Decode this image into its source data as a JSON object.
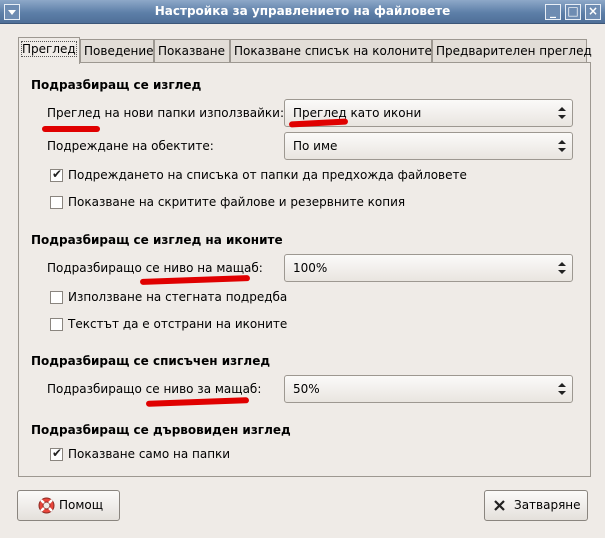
{
  "window": {
    "title": "Настройка за управлението на файловете"
  },
  "tabs": [
    {
      "label": "Преглед",
      "active": true
    },
    {
      "label": "Поведение",
      "active": false
    },
    {
      "label": "Показване",
      "active": false
    },
    {
      "label": "Показване списък на колоните",
      "active": false
    },
    {
      "label": "Предварителен преглед",
      "active": false
    }
  ],
  "default_view": {
    "heading": "Подразбиращ се изглед",
    "new_folders_label": "Преглед на нови папки използвайки:",
    "new_folders_value": "Преглед като икони",
    "arrange_label": "Подреждане на обектите:",
    "arrange_value": "По име",
    "folders_first_label": "Подреждането на списъка от папки да предхожда файловете",
    "folders_first_checked": true,
    "show_hidden_label": "Показване на скритите файлове и резервните копия",
    "show_hidden_checked": false
  },
  "icon_view": {
    "heading": "Подразбиращ се изглед на иконите",
    "zoom_label": "Подразбиращо се ниво на мащаб:",
    "zoom_value": "100%",
    "compact_label": "Използване на стегната подредба",
    "compact_checked": false,
    "text_beside_label": "Текстът да е отстрани на иконите",
    "text_beside_checked": false
  },
  "list_view": {
    "heading": "Подразбиращ се списъчен изглед",
    "zoom_label": "Подразбиращо се ниво за мащаб:",
    "zoom_value": "50%"
  },
  "tree_view": {
    "heading": "Подразбиращ се дървовиден изглед",
    "only_folders_label": "Показване само на папки",
    "only_folders_checked": true
  },
  "buttons": {
    "help": "Помощ",
    "close": "Затваряне"
  },
  "annotation_color": "#e00000"
}
